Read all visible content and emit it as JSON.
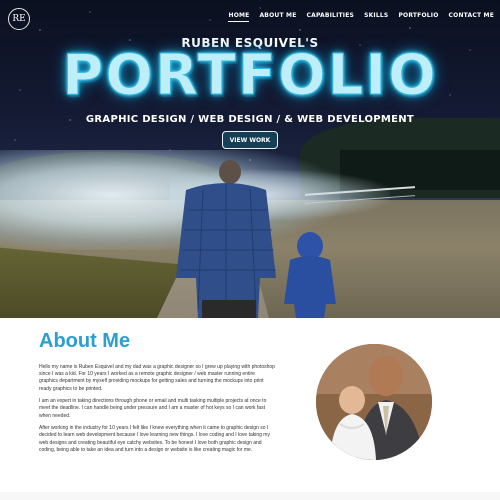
{
  "logo": {
    "text": "RE"
  },
  "nav": {
    "items": [
      {
        "label": "HOME",
        "active": true
      },
      {
        "label": "ABOUT ME",
        "active": false
      },
      {
        "label": "CAPABILITIES",
        "active": false
      },
      {
        "label": "SKILLS",
        "active": false
      },
      {
        "label": "PORTFOLIO",
        "active": false
      },
      {
        "label": "CONTACT ME",
        "active": false
      }
    ]
  },
  "hero": {
    "subtitle": "RUBEN ESQUIVEL'S",
    "title": "PORTFOLIO",
    "tagline": "GRAPHIC DESIGN / WEB DESIGN / & WEB DEVELOPMENT",
    "cta_label": "VIEW WORK"
  },
  "about": {
    "title": "About Me",
    "paragraphs": [
      "Hello my name is Ruben Esquivel and my dad was a graphic designer so I grew up playing with photoshop since I was a kid. For 10 years I worked as a remote graphic designer / web master running entire graphics department by myself providing mockups for getting sales and turning the mockups into print ready graphics to be printed.",
      "I am an expert in taking directions through phone or email and multi tasking multiple projects at once to meet the deadline. I can handle being under pressure and I am a master of hot keys so I can work fast when needed.",
      "After working in the industry for 10 years I felt like I knew everything when it came to graphic design so I decided to learn web development because I love learning new things. I love coding and I love taking my web designs and creating beautiful eye catchy websites. To be honest I love both graphic design and coding, being able to take an idea and turn into a design or website is like creating magic for me."
    ]
  },
  "colors": {
    "accent": "#2a9fd0",
    "title_glow": "#1aa9d8",
    "text": "#333333"
  }
}
